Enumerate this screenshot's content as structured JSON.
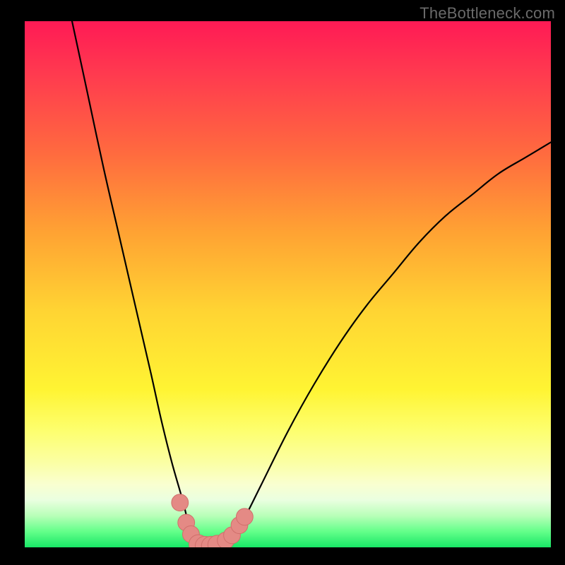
{
  "watermark": {
    "text": "TheBottleneck.com"
  },
  "colors": {
    "frame": "#000000",
    "curve": "#000000",
    "marker_fill": "#e48a85",
    "marker_stroke": "#d06f6b"
  },
  "chart_data": {
    "type": "line",
    "title": "",
    "xlabel": "",
    "ylabel": "",
    "xlim": [
      0,
      100
    ],
    "ylim": [
      0,
      100
    ],
    "grid": false,
    "legend": false,
    "series": [
      {
        "name": "bottleneck-curve",
        "x": [
          9,
          12,
          15,
          18,
          21,
          24,
          26,
          28,
          30,
          31,
          32,
          33,
          34,
          35,
          36,
          37,
          38,
          40,
          42,
          45,
          50,
          55,
          60,
          65,
          70,
          75,
          80,
          85,
          90,
          95,
          100
        ],
        "values": [
          100,
          86,
          72,
          59,
          46,
          33,
          24,
          16,
          9,
          5,
          2,
          1,
          0.4,
          0.2,
          0.2,
          0.4,
          1,
          2.5,
          6,
          12,
          22,
          31,
          39,
          46,
          52,
          58,
          63,
          67,
          71,
          74,
          77
        ]
      }
    ],
    "markers": {
      "name": "highlight-points",
      "points": [
        {
          "x": 29.5,
          "y": 8.5,
          "r": 1.6
        },
        {
          "x": 30.7,
          "y": 4.7,
          "r": 1.6
        },
        {
          "x": 31.6,
          "y": 2.5,
          "r": 1.6
        },
        {
          "x": 33.0,
          "y": 0.6,
          "r": 1.8
        },
        {
          "x": 34.2,
          "y": 0.3,
          "r": 1.8
        },
        {
          "x": 35.4,
          "y": 0.3,
          "r": 1.8
        },
        {
          "x": 36.6,
          "y": 0.5,
          "r": 1.8
        },
        {
          "x": 38.2,
          "y": 1.3,
          "r": 1.6
        },
        {
          "x": 39.4,
          "y": 2.3,
          "r": 1.6
        },
        {
          "x": 40.8,
          "y": 4.2,
          "r": 1.6
        },
        {
          "x": 41.8,
          "y": 5.8,
          "r": 1.6
        }
      ]
    }
  }
}
